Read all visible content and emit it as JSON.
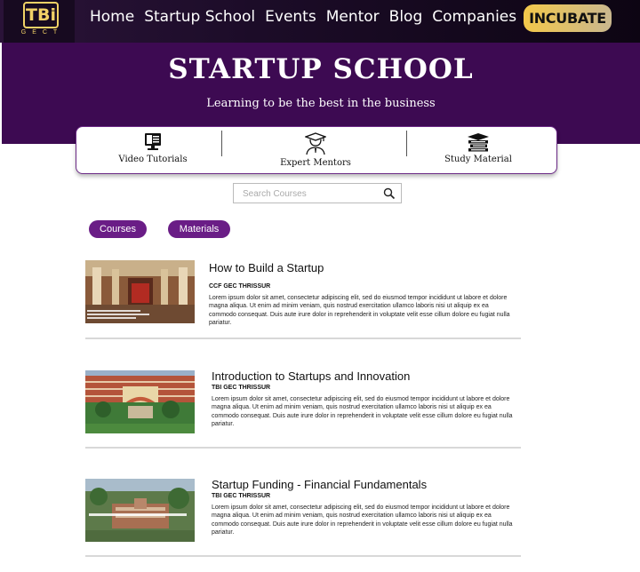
{
  "brand": {
    "logo_text": "TBi",
    "logo_sub": "GECT"
  },
  "nav": {
    "items": [
      "Home",
      "Startup School",
      "Events",
      "Mentor",
      "Blog",
      "Companies"
    ],
    "cta_label": "INCUBATE"
  },
  "hero": {
    "title": "STARTUP SCHOOL",
    "subtitle": "Learning to be the best in the business"
  },
  "features": [
    {
      "label": "Video Tutorials",
      "icon": "video-tutorial-icon"
    },
    {
      "label": "Expert Mentors",
      "icon": "mentor-icon"
    },
    {
      "label": "Study Material",
      "icon": "books-icon"
    }
  ],
  "search": {
    "placeholder": "Search Courses",
    "value": ""
  },
  "filters": {
    "courses_label": "Courses",
    "materials_label": "Materials"
  },
  "courses": [
    {
      "title": "How to Build a Startup",
      "org": "CCF GEC THRISSUR",
      "description": "Lorem ipsum dolor sit amet, consectetur adipiscing elit, sed do eiusmod tempor incididunt ut labore et dolore magna aliqua. Ut enim ad minim veniam, quis nostrud exercitation ullamco laboris nisi ut aliquip ex ea commodo consequat. Duis aute irure dolor in reprehenderit in voluptate velit esse cillum dolore eu fugiat nulla pariatur."
    },
    {
      "title": "Introduction to Startups and Innovation",
      "org": "TBI GEC THRISSUR",
      "description": "Lorem ipsum dolor sit amet, consectetur adipiscing elit, sed do eiusmod tempor incididunt ut labore et dolore magna aliqua. Ut enim ad minim veniam, quis nostrud exercitation ullamco laboris nisi ut aliquip ex ea commodo consequat. Duis aute irure dolor in reprehenderit in voluptate velit esse cillum dolore eu fugiat nulla pariatur."
    },
    {
      "title": "Startup Funding - Financial Fundamentals",
      "org": "TBI GEC THRISSUR",
      "description": "Lorem ipsum dolor sit amet, consectetur adipiscing elit, sed do eiusmod tempor incididunt ut labore et dolore magna aliqua. Ut enim ad minim veniam, quis nostrud exercitation ullamco laboris nisi ut aliquip ex ea commodo consequat. Duis aute irure dolor in reprehenderit in voluptate velit esse cillum dolore eu fugiat nulla pariatur."
    }
  ],
  "colors": {
    "primary": "#3d0a52",
    "accent": "#f3c84a",
    "pill": "#6a1d86"
  }
}
